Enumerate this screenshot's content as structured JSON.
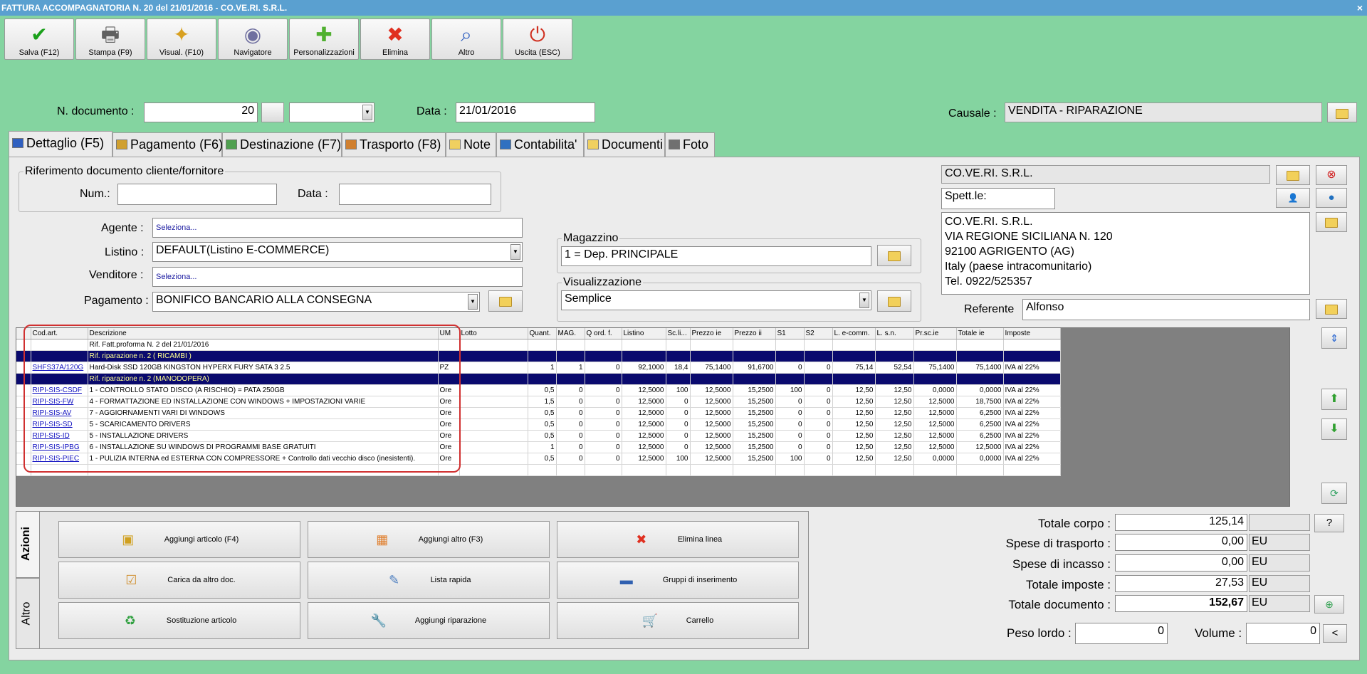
{
  "window": {
    "title": "FATTURA ACCOMPAGNATORIA N. 20 del 21/01/2016 - CO.VE.RI. S.R.L.",
    "close": "×"
  },
  "toolbar": [
    {
      "label": "Salva (F12)",
      "icon": "check-icon",
      "glyph": "✔",
      "color": "#1aa01a"
    },
    {
      "label": "Stampa (F9)",
      "icon": "printer-icon",
      "glyph": "🖶",
      "color": "#606060"
    },
    {
      "label": "Visual. (F10)",
      "icon": "magic-wand-icon",
      "glyph": "✦",
      "color": "#d8a020"
    },
    {
      "label": "Navigatore",
      "icon": "eye-icon",
      "glyph": "◉",
      "color": "#7070a0"
    },
    {
      "label": "Personalizzazioni",
      "icon": "puzzle-icon",
      "glyph": "✚",
      "color": "#50b030"
    },
    {
      "label": "Elimina",
      "icon": "delete-x-icon",
      "glyph": "✖",
      "color": "#e03020"
    },
    {
      "label": "Altro",
      "icon": "magnifier-icon",
      "glyph": "⌕",
      "color": "#3060c0"
    },
    {
      "label": "Uscita (ESC)",
      "icon": "power-icon",
      "glyph": "⏻",
      "color": "#d03020"
    }
  ],
  "header": {
    "ndoc_label": "N. documento :",
    "ndoc_value": "20",
    "data_label": "Data :",
    "data_value": "21/01/2016",
    "causale_label": "Causale :",
    "causale_value": "VENDITA - RIPARAZIONE"
  },
  "tabs": [
    "Dettaglio (F5)",
    "Pagamento (F6)",
    "Destinazione (F7)",
    "Trasporto (F8)",
    "Note",
    "Contabilita'",
    "Documenti",
    "Foto"
  ],
  "rif": {
    "legend": "Riferimento documento cliente/fornitore",
    "num_label": "Num.:",
    "data_label": "Data :",
    "num_value": "",
    "data_value": ""
  },
  "fields": {
    "agente_label": "Agente :",
    "agente_value": "Seleziona...",
    "listino_label": "Listino :",
    "listino_value": "DEFAULT(Listino E-COMMERCE)",
    "venditore_label": "Venditore :",
    "venditore_value": "Seleziona...",
    "pagamento_label": "Pagamento :",
    "pagamento_value": "BONIFICO BANCARIO ALLA CONSEGNA"
  },
  "magazzino": {
    "legend": "Magazzino",
    "value": "1 = Dep. PRINCIPALE"
  },
  "visualizzazione": {
    "legend": "Visualizzazione",
    "value": "Semplice"
  },
  "cliente": {
    "name": "CO.VE.RI. S.R.L.",
    "spett": "Spett.le:",
    "address": [
      "CO.VE.RI. S.R.L.",
      "VIA REGIONE SICILIANA N. 120",
      "92100 AGRIGENTO (AG)",
      "Italy (paese intracomunitario)",
      "Tel. 0922/525357"
    ],
    "referente_label": "Referente",
    "referente_value": "Alfonso"
  },
  "grid": {
    "columns": [
      "",
      "Cod.art.",
      "Descrizione",
      "UM",
      "Lotto",
      "Quant.",
      "MAG.",
      "Q ord. f.",
      "Listino",
      "Sc.li...",
      "Prezzo ie",
      "Prezzo ii",
      "S1",
      "S2",
      "L. e-comm.",
      "L. s.n.",
      "Pr.sc.ie",
      "Totale ie",
      "Imposte"
    ],
    "rows": [
      {
        "type": "note",
        "cells": [
          "",
          "",
          "Rif. Fatt.proforma N. 2 del 21/01/2016",
          "",
          "",
          "",
          "",
          "",
          "",
          "",
          "",
          "",
          "",
          "",
          "",
          "",
          "",
          "",
          ""
        ]
      },
      {
        "type": "hdr",
        "cells": [
          "",
          "",
          "Rif. riparazione n. 2 ( RICAMBI )",
          "",
          "",
          "",
          "",
          "",
          "",
          "",
          "",
          "",
          "",
          "",
          "",
          "",
          "",
          "",
          ""
        ]
      },
      {
        "type": "item",
        "cells": [
          "",
          "SHFS37A/120G",
          "Hard-Disk SSD 120GB KINGSTON HYPERX FURY SATA 3 2.5",
          "PZ",
          "",
          "1",
          "1",
          "0",
          "92,1000",
          "18,4",
          "75,1400",
          "91,6700",
          "0",
          "0",
          "75,14",
          "52,54",
          "75,1400",
          "75,1400",
          "IVA al 22%"
        ]
      },
      {
        "type": "hdr",
        "cells": [
          "",
          "",
          "Rif. riparazione n. 2 (MANODOPERA)",
          "",
          "",
          "",
          "",
          "",
          "",
          "",
          "",
          "",
          "",
          "",
          "",
          "",
          "",
          "",
          ""
        ]
      },
      {
        "type": "item",
        "cells": [
          "",
          "RIPI-SIS-CSDF",
          "1 - CONTROLLO STATO DISCO (A RISCHIO) = PATA 250GB",
          "Ore",
          "",
          "0,5",
          "0",
          "0",
          "12,5000",
          "100",
          "12,5000",
          "15,2500",
          "100",
          "0",
          "12,50",
          "12,50",
          "0,0000",
          "0,0000",
          "IVA al 22%"
        ]
      },
      {
        "type": "item",
        "cells": [
          "",
          "RIPI-SIS-FW",
          "4 - FORMATTAZIONE ED INSTALLAZIONE CON WINDOWS + IMPOSTAZIONI VARIE",
          "Ore",
          "",
          "1,5",
          "0",
          "0",
          "12,5000",
          "0",
          "12,5000",
          "15,2500",
          "0",
          "0",
          "12,50",
          "12,50",
          "12,5000",
          "18,7500",
          "IVA al 22%"
        ]
      },
      {
        "type": "item",
        "cells": [
          "",
          "RIPI-SIS-AV",
          "7 - AGGIORNAMENTI VARI DI WINDOWS",
          "Ore",
          "",
          "0,5",
          "0",
          "0",
          "12,5000",
          "0",
          "12,5000",
          "15,2500",
          "0",
          "0",
          "12,50",
          "12,50",
          "12,5000",
          "6,2500",
          "IVA al 22%"
        ]
      },
      {
        "type": "item",
        "cells": [
          "",
          "RIPI-SIS-SD",
          "5 - SCARICAMENTO DRIVERS",
          "Ore",
          "",
          "0,5",
          "0",
          "0",
          "12,5000",
          "0",
          "12,5000",
          "15,2500",
          "0",
          "0",
          "12,50",
          "12,50",
          "12,5000",
          "6,2500",
          "IVA al 22%"
        ]
      },
      {
        "type": "item",
        "cells": [
          "",
          "RIPI-SIS-ID",
          "5 - INSTALLAZIONE DRIVERS",
          "Ore",
          "",
          "0,5",
          "0",
          "0",
          "12,5000",
          "0",
          "12,5000",
          "15,2500",
          "0",
          "0",
          "12,50",
          "12,50",
          "12,5000",
          "6,2500",
          "IVA al 22%"
        ]
      },
      {
        "type": "item",
        "cells": [
          "",
          "RIPI-SIS-IPBG",
          "6 - INSTALLAZIONE SU WINDOWS DI PROGRAMMI BASE GRATUITI",
          "Ore",
          "",
          "1",
          "0",
          "0",
          "12,5000",
          "0",
          "12,5000",
          "15,2500",
          "0",
          "0",
          "12,50",
          "12,50",
          "12,5000",
          "12,5000",
          "IVA al 22%"
        ]
      },
      {
        "type": "item",
        "cells": [
          "",
          "RIPI-SIS-PIEC",
          "1 - PULIZIA INTERNA ed ESTERNA CON COMPRESSORE + Controllo dati vecchio disco (inesistenti).",
          "Ore",
          "",
          "0,5",
          "0",
          "0",
          "12,5000",
          "100",
          "12,5000",
          "15,2500",
          "100",
          "0",
          "12,50",
          "12,50",
          "0,0000",
          "0,0000",
          "IVA al 22%"
        ]
      },
      {
        "type": "empty",
        "cells": [
          "",
          "",
          "",
          "",
          "",
          "",
          "",
          "",
          "",
          "",
          "",
          "",
          "",
          "",
          "",
          "",
          "",
          "",
          ""
        ]
      }
    ]
  },
  "actions": {
    "vtab_azioni": "Azioni",
    "vtab_altro": "Altro",
    "buttons": [
      {
        "label": "Aggiungi articolo (F4)",
        "glyph": "▣",
        "color": "#d0a020"
      },
      {
        "label": "Aggiungi altro (F3)",
        "glyph": "▦",
        "color": "#e08030"
      },
      {
        "label": "Elimina linea",
        "glyph": "✖",
        "color": "#e03020"
      },
      {
        "label": "Carica da altro doc.",
        "glyph": "☑",
        "color": "#d09030"
      },
      {
        "label": "Lista rapida",
        "glyph": "✎",
        "color": "#5080c0"
      },
      {
        "label": "Gruppi di inserimento",
        "glyph": "▬",
        "color": "#3060b0"
      },
      {
        "label": "Sostituzione articolo",
        "glyph": "♻",
        "color": "#30a040"
      },
      {
        "label": "Aggiungi riparazione",
        "glyph": "🔧",
        "color": "#808080"
      },
      {
        "label": "Carrello",
        "glyph": "🛒",
        "color": "#707070"
      }
    ]
  },
  "totals": {
    "corpo_label": "Totale corpo :",
    "corpo_value": "125,14",
    "trasporto_label": "Spese di trasporto :",
    "trasporto_value": "0,00",
    "trasporto_unit": "EU",
    "incasso_label": "Spese di incasso :",
    "incasso_value": "0,00",
    "incasso_unit": "EU",
    "imposte_label": "Totale imposte :",
    "imposte_value": "27,53",
    "imposte_unit": "EU",
    "documento_label": "Totale documento :",
    "documento_value": "152,67",
    "documento_unit": "EU",
    "peso_label": "Peso lordo :",
    "peso_value": "0",
    "volume_label": "Volume :",
    "volume_value": "0",
    "help": "?",
    "less": "<"
  }
}
